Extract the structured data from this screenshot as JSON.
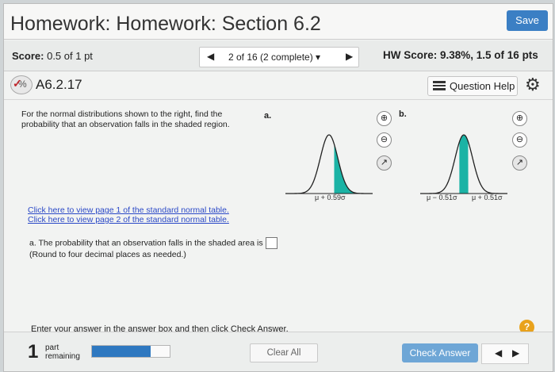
{
  "header": {
    "title": "Homework: Homework: Section 6.2",
    "save_label": "Save"
  },
  "scorebar": {
    "score_label": "Score:",
    "score_value": "0.5 of 1 pt",
    "question_nav": "2 of 16 (2 complete) ▾",
    "hw_score": "HW Score: 9.38%, 1.5 of 16 pts"
  },
  "question": {
    "id": "A6.2.17",
    "help_label": "Question Help",
    "prompt": "For the normal distributions shown to the right, find the probability that an observation falls in the shaded region.",
    "part_a_label": "a.",
    "part_b_label": "b.",
    "graph_a_label": "μ + 0.59σ",
    "graph_b_left_label": "μ − 0.51σ",
    "graph_b_right_label": "μ + 0.51σ",
    "link1": "Click here to view page 1 of the standard normal table.",
    "link2": "Click here to view page 2 of the standard normal table.",
    "answer_prompt": "a. The probability that an observation falls in the shaded area is",
    "answer_value": "",
    "answer_note": "(Round to four decimal places as needed.)",
    "instruction": "Enter your answer in the answer box and then click Check Answer.",
    "shade_color": "#1bb3a5"
  },
  "footer": {
    "part_count": "1",
    "part_line1": "part",
    "part_line2": "remaining",
    "progress_fraction": 0.75,
    "clear_label": "Clear All",
    "check_label": "Check Answer"
  }
}
